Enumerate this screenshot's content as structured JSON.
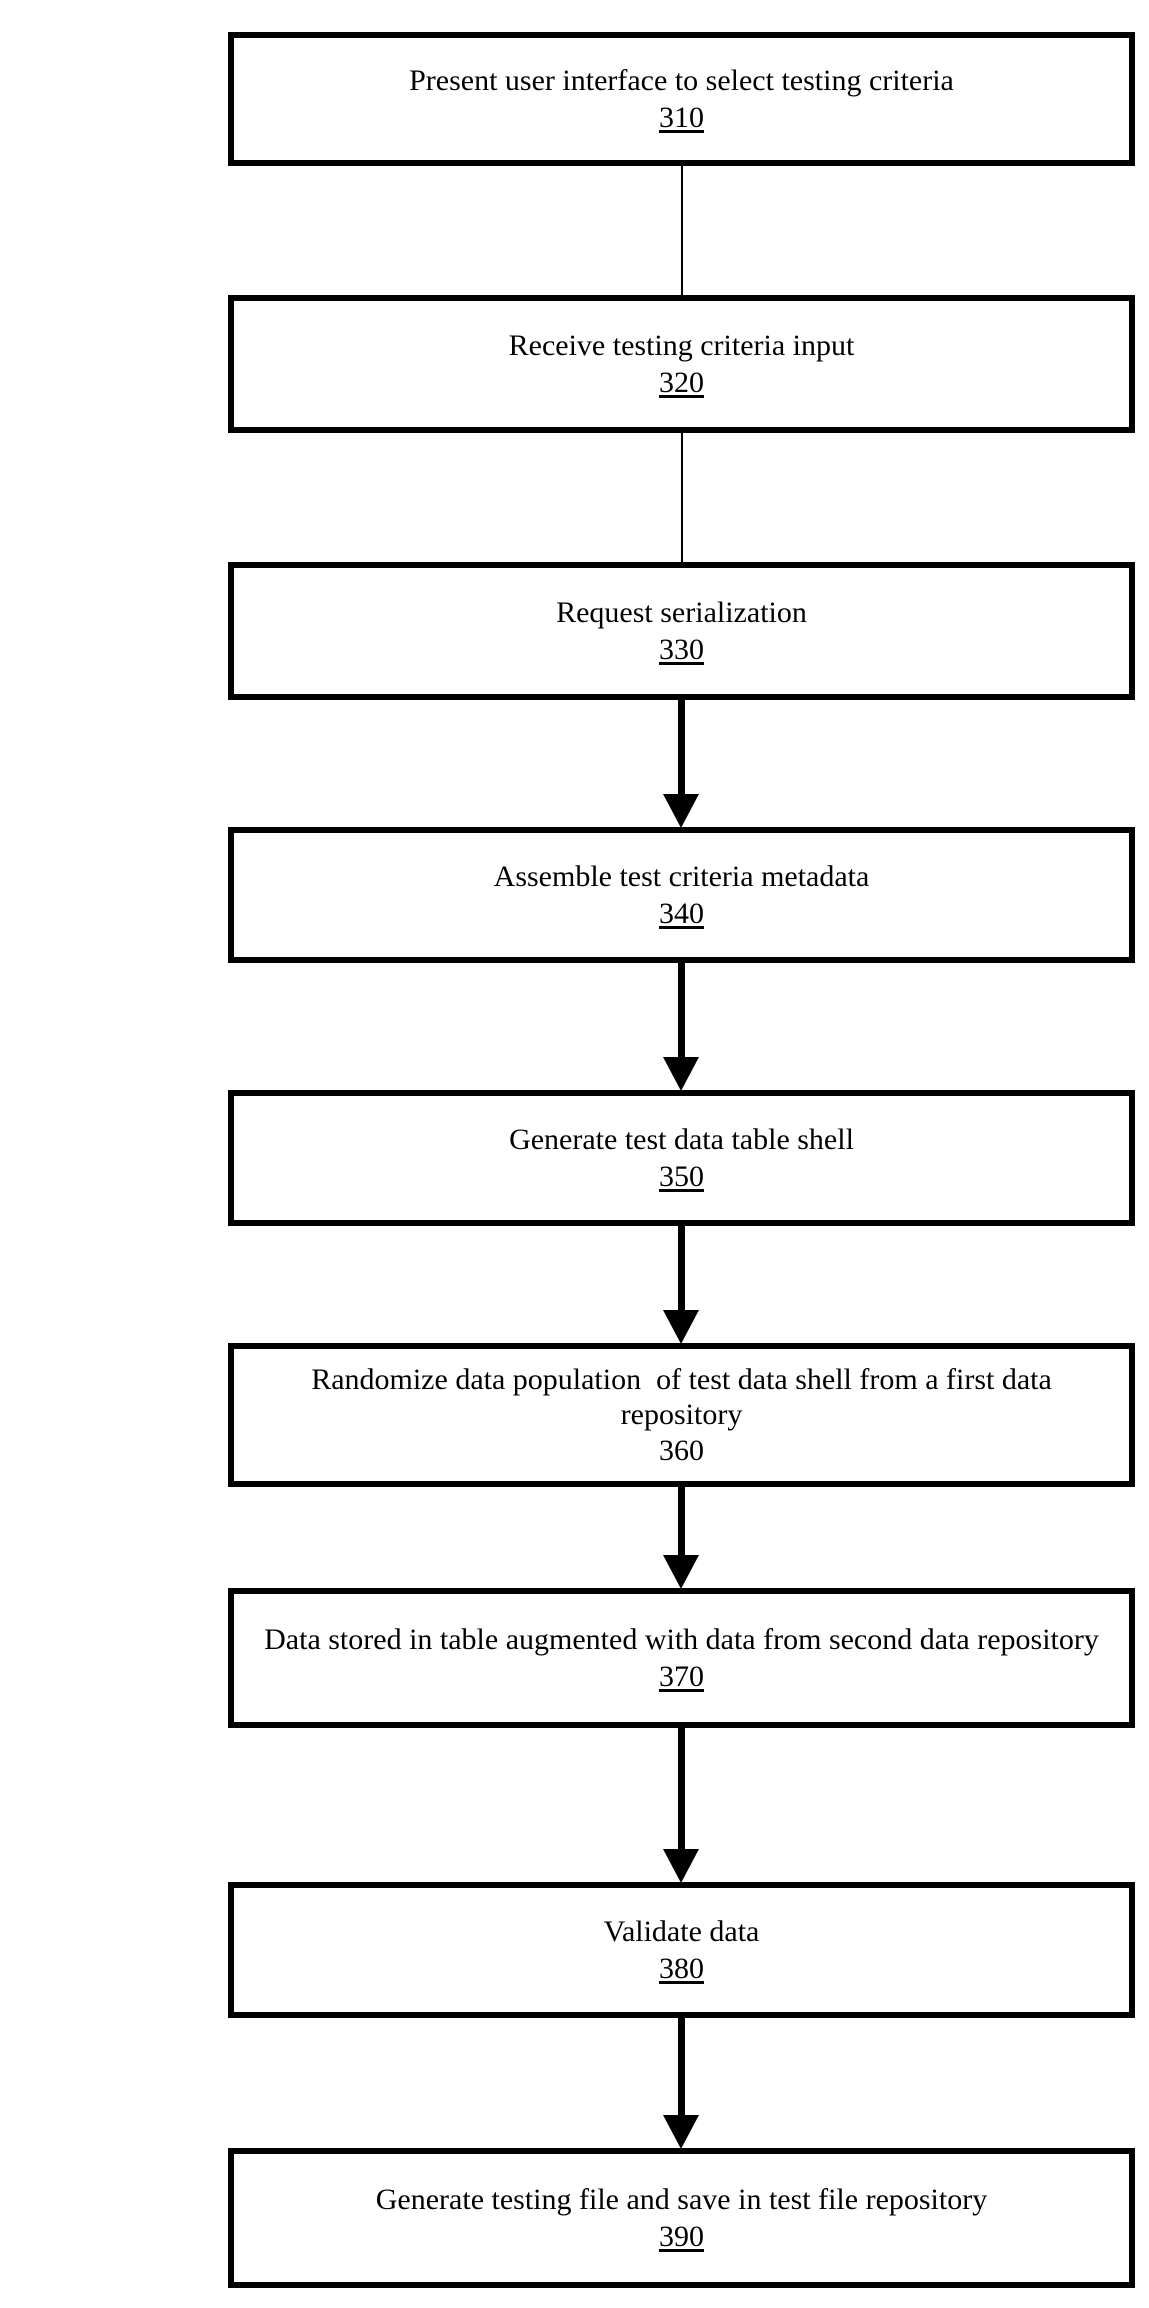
{
  "diagram": {
    "title": "Testing data generation process flowchart",
    "orientation": "top-to-bottom",
    "background_color": "#ffffff",
    "line_color": "#000000",
    "nodes": [
      {
        "id": "n310",
        "label": "Present user interface to select testing criteria",
        "ref": "310",
        "ref_underlined": true
      },
      {
        "id": "n320",
        "label": "Receive testing criteria input",
        "ref": "320",
        "ref_underlined": true
      },
      {
        "id": "n330",
        "label": "Request serialization",
        "ref": "330",
        "ref_underlined": true
      },
      {
        "id": "n340",
        "label": "Assemble test criteria metadata",
        "ref": "340",
        "ref_underlined": true
      },
      {
        "id": "n350",
        "label": "Generate test data table shell",
        "ref": "350",
        "ref_underlined": true
      },
      {
        "id": "n360",
        "label": "Randomize data population  of test data shell from a first data repository",
        "ref": "360",
        "ref_underlined": false
      },
      {
        "id": "n370",
        "label": "Data stored in table augmented with data from second data repository",
        "ref": "370",
        "ref_underlined": true
      },
      {
        "id": "n380",
        "label": "Validate data",
        "ref": "380",
        "ref_underlined": true
      },
      {
        "id": "n390",
        "label": "Generate testing file and save in test file repository",
        "ref": "390",
        "ref_underlined": true
      }
    ],
    "connectors": [
      {
        "id": "c1",
        "from": "n310",
        "to": "n320",
        "style": "thin-line",
        "arrowhead": false
      },
      {
        "id": "c2",
        "from": "n320",
        "to": "n330",
        "style": "thin-line",
        "arrowhead": false
      },
      {
        "id": "c3",
        "from": "n330",
        "to": "n340",
        "style": "thick-arrow",
        "arrowhead": true
      },
      {
        "id": "c4",
        "from": "n340",
        "to": "n350",
        "style": "thick-arrow",
        "arrowhead": true
      },
      {
        "id": "c5",
        "from": "n350",
        "to": "n360",
        "style": "thick-arrow",
        "arrowhead": true
      },
      {
        "id": "c6",
        "from": "n360",
        "to": "n370",
        "style": "thick-arrow",
        "arrowhead": true
      },
      {
        "id": "c7",
        "from": "n370",
        "to": "n380",
        "style": "thick-arrow",
        "arrowhead": true
      },
      {
        "id": "c8",
        "from": "n380",
        "to": "n390",
        "style": "thick-arrow",
        "arrowhead": true
      }
    ]
  }
}
